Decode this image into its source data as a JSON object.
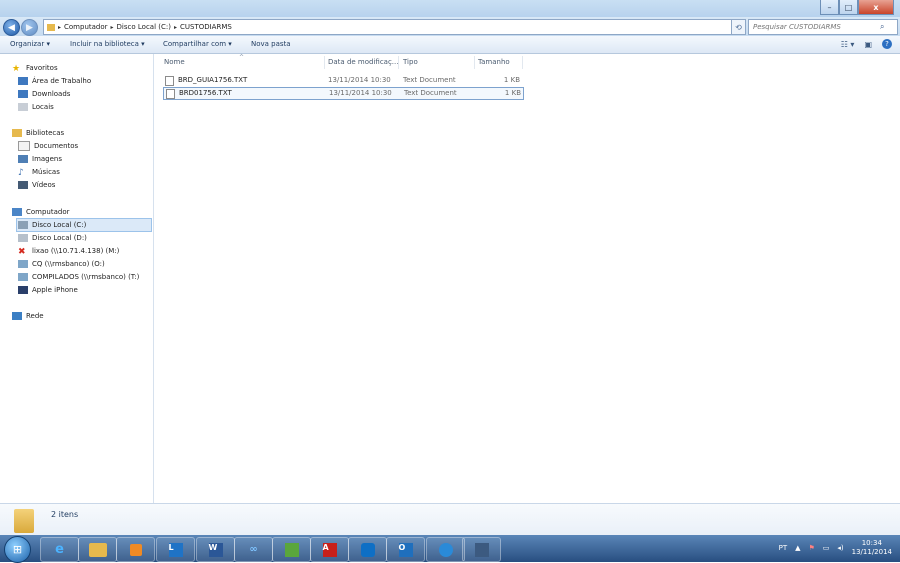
{
  "window": {
    "minimize": "–",
    "maximize": "□",
    "close": "x"
  },
  "address": {
    "back_icon": "back-arrow-icon",
    "forward_icon": "forward-arrow-icon",
    "crumbs": [
      "Computador",
      "Disco Local (C:)",
      "CUSTODIARMS"
    ],
    "search_placeholder": "Pesquisar CUSTODIARMS"
  },
  "toolbar": {
    "organize": "Organizar ▾",
    "include_library": "Incluir na biblioteca ▾",
    "share": "Compartilhar com ▾",
    "new_folder": "Nova pasta"
  },
  "nav": {
    "favorites": "Favoritos",
    "desktop": "Área de Trabalho",
    "downloads": "Downloads",
    "places": "Locais",
    "libraries": "Bibliotecas",
    "documents": "Documentos",
    "images": "Imagens",
    "music": "Músicas",
    "videos": "Vídeos",
    "computer": "Computador",
    "disk_c": "Disco Local (C:)",
    "disk_d": "Disco Local (D:)",
    "lixao": "lixao (\\\\10.71.4.138) (M:)",
    "cq": "CQ (\\\\rmsbanco) (O:)",
    "compilados": "COMPILADOS (\\\\rmsbanco) (T:)",
    "iphone": "Apple iPhone",
    "network": "Rede"
  },
  "columns": {
    "name": "Nome",
    "modified": "Data de modificaç...",
    "type": "Tipo",
    "size": "Tamanho"
  },
  "files": [
    {
      "name": "BRD_GUIA1756.TXT",
      "modified": "13/11/2014 10:30",
      "type": "Text Document",
      "size": "1 KB"
    },
    {
      "name": "BRD01756.TXT",
      "modified": "13/11/2014 10:30",
      "type": "Text Document",
      "size": "1 KB"
    }
  ],
  "status": {
    "count": "2 itens"
  },
  "taskbar": {
    "lang": "PT",
    "time": "10:34",
    "date": "13/11/2014"
  },
  "colors": {
    "selection": "#dbe9f8",
    "taskbar": "#284e80",
    "folder": "#e6b94d"
  }
}
